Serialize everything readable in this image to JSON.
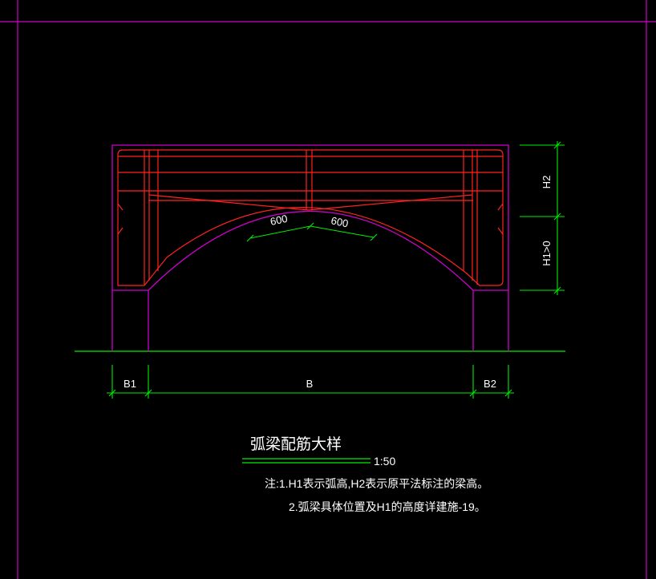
{
  "colors": {
    "background": "#000000",
    "frame": "#cc00cc",
    "concrete_outline": "#cc00cc",
    "rebar": "#ff2222",
    "dimension": "#00ee00",
    "text": "#ffffff"
  },
  "title": "弧梁配筋大样",
  "scale": "1:50",
  "notes": {
    "line1": "注:1.H1表示弧高,H2表示原平法标注的梁高。",
    "line2": "2.弧梁具体位置及H1的高度详建施-19。"
  },
  "dimensions": {
    "left_support": "B1",
    "span": "B",
    "right_support": "B2",
    "beam_height": "H2",
    "arch_height": "H1>0",
    "segment_left": "600",
    "segment_right": "600"
  }
}
